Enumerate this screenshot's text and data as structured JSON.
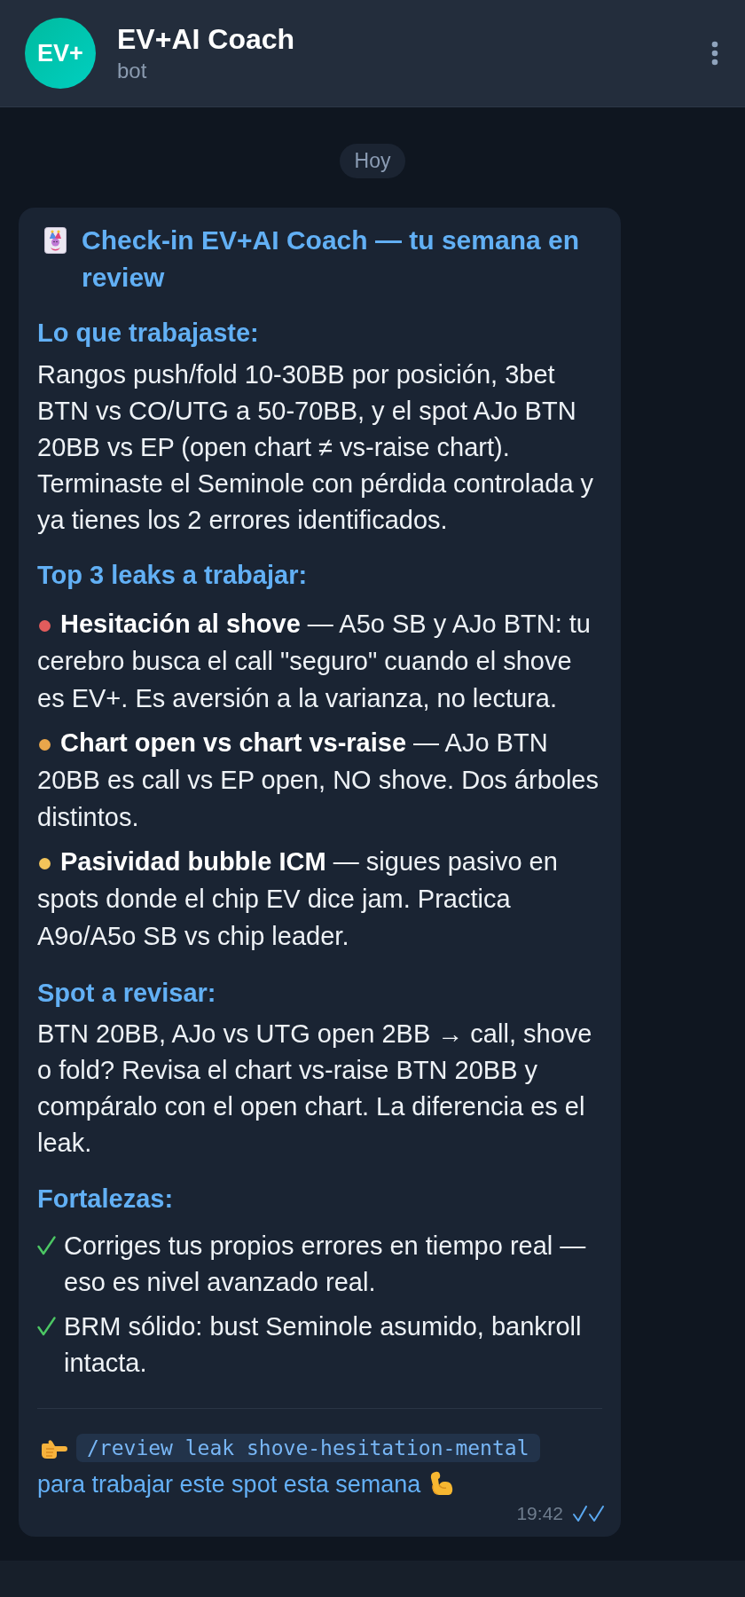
{
  "header": {
    "avatar": "EV+",
    "title": "EV+AI Coach",
    "subtitle": "bot"
  },
  "date_separator": "Hoy",
  "message": {
    "title": "Check-in EV+AI Coach — tu semana en review",
    "sections": [
      {
        "kind": "paragraph",
        "heading": "Lo que trabajaste:",
        "text": "Rangos push/fold 10-30BB por posición, 3bet BTN vs CO/UTG a 50-70BB, y el spot AJo BTN 20BB vs EP (open chart ≠ vs-raise chart). Terminaste el Seminole con pérdida controlada y ya tienes los 2 errores identificados."
      },
      {
        "kind": "bullets",
        "heading": "Top 3 leaks a trabajar:",
        "items": [
          {
            "color": "#e25c5c",
            "text": "**Hesitación al shove** — A5o SB y AJo BTN: tu cerebro busca el call \"seguro\" cuando el shove es EV+. Es aversión a la varianza, no lectura."
          },
          {
            "color": "#e9a64b",
            "text": "**Chart open vs chart vs-raise** — AJo BTN 20BB es call vs EP open, NO shove. Dos árboles distintos."
          },
          {
            "color": "#f2c45a",
            "text": "**Pasividad bubble ICM** — sigues pasivo en spots donde el chip EV dice jam. Practica A9o/A5o SB vs chip leader."
          }
        ]
      },
      {
        "kind": "paragraph",
        "heading": "Spot a revisar:",
        "text": "BTN 20BB, AJo vs UTG open 2BB → call, shove o fold? Revisa el chart vs-raise BTN 20BB y compáralo con el open chart. La diferencia es el leak."
      },
      {
        "kind": "checks",
        "heading": "Fortalezas:",
        "items": [
          {
            "text": "Corriges tus propios errores en tiempo real — eso es nivel avanzado real."
          },
          {
            "text": "BRM sólido: bust Seminole asumido, bankroll intacta."
          }
        ]
      }
    ],
    "command": "/review leak shove-hesitation-mental",
    "command_note": "para trabajar este spot esta semana",
    "time": "19:42",
    "read": true
  }
}
